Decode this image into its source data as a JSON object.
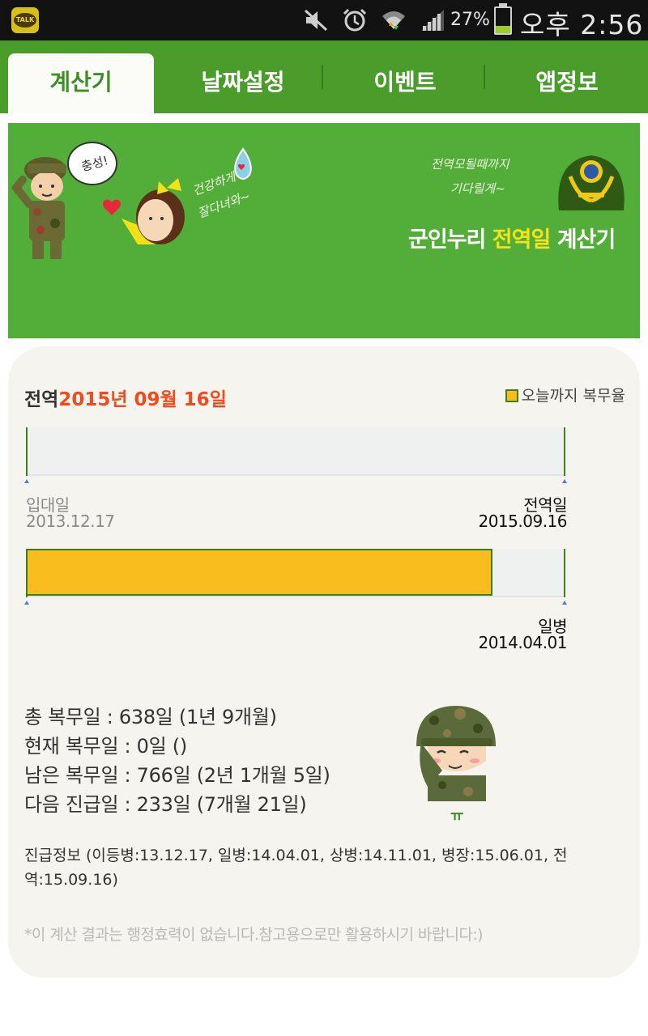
{
  "status_bar": {
    "notification_icon": "kakaotalk-icon",
    "notification_icon_text": "TALK",
    "icons": [
      "mute-icon",
      "alarm-icon",
      "wifi-icon",
      "signal-icon",
      "battery-icon"
    ],
    "battery_percent": "27%",
    "time": "오후 2:56"
  },
  "tabs": [
    {
      "label": "계산기",
      "active": true
    },
    {
      "label": "날짜설정",
      "active": false
    },
    {
      "label": "이벤트",
      "active": false
    },
    {
      "label": "앱정보",
      "active": false
    }
  ],
  "banner": {
    "title_part1": "군인누리 ",
    "title_highlight": "전역일",
    "title_part2": " 계산기",
    "bubble_text": "충성!",
    "handwriting_left_1": "건강하게",
    "handwriting_left_2": "잘다녀와~",
    "handwriting_right_1": "전역모될때까지",
    "handwriting_right_2": "기다릴게~"
  },
  "summary": {
    "discharge_prefix": "전역",
    "discharge_date": "2015년 09월 16일",
    "legend_label": "오늘까지 복무율"
  },
  "bars": {
    "service": {
      "progress": 0,
      "start_label": "입대일",
      "start_date": "2013.12.17",
      "end_label": "전역일",
      "end_date": "2015.09.16"
    },
    "rank": {
      "progress": 0.865,
      "end_label": "일병",
      "end_date": "2014.04.01"
    }
  },
  "stats": {
    "total": "총 복무일 : 638일 (1년 9개월)",
    "current": "현재 복무일 : 0일 ()",
    "remaining": "남은 복무일 : 766일 (2년 1개월 5일)",
    "next_promotion": "다음 진급일 : 233일 (7개월 21일)"
  },
  "soldier_caption": "ㅠ",
  "promotion_info": "진급정보 (이등병:13.12.17, 일병:14.04.01, 상병:14.11.01, 병장:15.06.01, 전역:15.09.16)",
  "disclaimer": "*이 계산 결과는 행정효력이 없습니다.참고용으로만 활용하시기 바랍니다:)",
  "colors": {
    "tab_bar": "#4b9d2b",
    "banner": "#52ae38",
    "accent_date": "#f04b1c",
    "progress_fill": "#f9bd1d",
    "card_bg": "#f6f4ee"
  }
}
